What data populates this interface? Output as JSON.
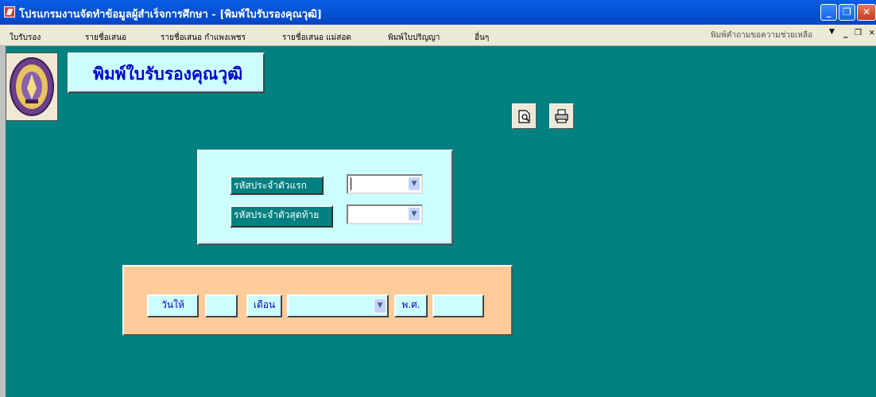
{
  "window": {
    "title": "โปรแกรมงานจัดทำข้อมูลผู้สำเร็จการศึกษา - [พิมพ์ใบรับรองคุณวุฒิ]",
    "minimize": "_",
    "restore": "❐",
    "close": "✕"
  },
  "menu": {
    "items": [
      "ใบรับรอง",
      "รายชื่อเสนอ",
      "รายชื่อเสนอ กำแพงเพชร",
      "รายชื่อเสนอ แม่สอด",
      "พิมพ์ใบปริญญา",
      "อื่นๆ"
    ],
    "help_placeholder": "พิมพ์คำถามขอความช่วยเหลือ",
    "mdi_minimize": "_",
    "mdi_restore": "❐",
    "mdi_close": "✕"
  },
  "form": {
    "title": "พิมพ์ใบรับรองคุณวุฒิ",
    "logo_icon": "university-seal",
    "preview_icon": "print-preview-icon",
    "print_icon": "printer-icon",
    "first_id_label": "รหัสประจำตัวแรก",
    "first_id_value": "",
    "last_id_label": "รหัสประจำตัวสุดท้าย",
    "last_id_value": "",
    "date_label": "วันให้",
    "day_value": "",
    "month_label": "เดือน",
    "month_value": "",
    "year_label": "พ.ศ.",
    "year_value": ""
  },
  "colors": {
    "background": "#008080",
    "panel_light": "#ccffff",
    "panel_peach": "#ffcc99",
    "title_text": "#0000cc"
  }
}
